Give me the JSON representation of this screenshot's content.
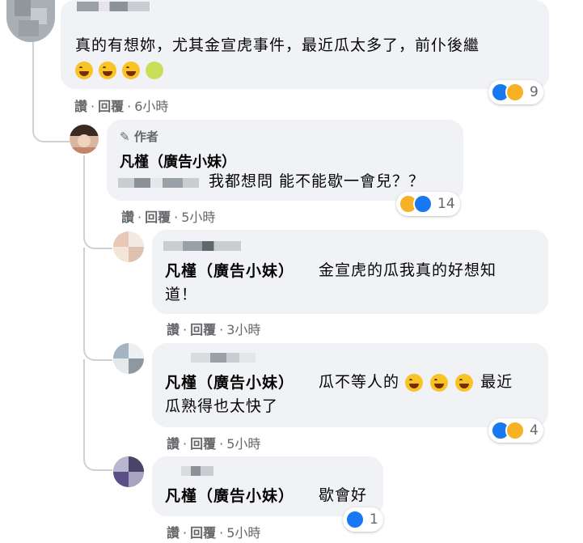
{
  "comments": {
    "top": {
      "text": "真的有想妳，尤其金宣虎事件，最近瓜太多了，前仆後繼",
      "reaction_count": "9",
      "actions": {
        "like": "讚",
        "reply": "回覆",
        "time": "6小時"
      }
    },
    "author_reply": {
      "badge": "作者",
      "name": "凡槿（廣告小妹）",
      "text": "我都想問 能不能歇一會兒？？",
      "reaction_count": "14",
      "actions": {
        "like": "讚",
        "reply": "回覆",
        "time": "5小時"
      }
    },
    "reply1": {
      "tag": "凡槿（廣告小妹）",
      "text_line1": "金宣虎的瓜我真的好想知",
      "text_line2": "道！",
      "actions": {
        "like": "讚",
        "reply": "回覆",
        "time": "3小時"
      }
    },
    "reply2": {
      "tag": "凡槿（廣告小妹）",
      "text_before": "瓜不等人的",
      "text_after": "最近",
      "text_line2": "瓜熟得也太快了",
      "reaction_count": "4",
      "actions": {
        "like": "讚",
        "reply": "回覆",
        "time": "5小時"
      }
    },
    "reply3": {
      "tag": "凡槿（廣告小妹）",
      "text": "歇會好",
      "reaction_count": "1",
      "actions": {
        "like": "讚",
        "reply": "回覆",
        "time": "5小時"
      }
    }
  },
  "separator": "·",
  "colors": {
    "bubble": "#f0f2f5",
    "meta": "#65676b",
    "like_blue": "#1877f2",
    "haha_yellow": "#f7b125"
  },
  "icons": [
    "pencil-icon",
    "like-icon",
    "haha-icon",
    "laughing-emoji",
    "melon-emoji"
  ]
}
